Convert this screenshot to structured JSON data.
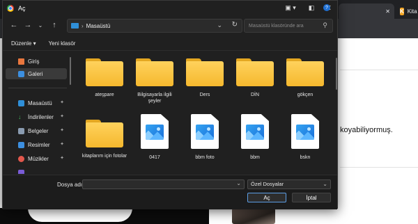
{
  "background": {
    "tab_k_letter": "K",
    "tab_k_label": "Kita",
    "article_text": "koyabiliyormuş."
  },
  "dialog": {
    "title": "Aç",
    "breadcrumb": {
      "location": "Masaüstü"
    },
    "search_placeholder": "Masaüstü klasöründe ara",
    "commands": {
      "organize": "Düzenle ▾",
      "new_folder": "Yeni klasör"
    },
    "sidebar": {
      "top_items": [
        {
          "label": "Giriş",
          "icon": "home-icon"
        },
        {
          "label": "Galeri",
          "icon": "gallery-icon"
        }
      ],
      "pinned_items": [
        {
          "label": "Masaüstü",
          "icon": "desktop-icon"
        },
        {
          "label": "İndirilenler",
          "icon": "download-icon"
        },
        {
          "label": "Belgeler",
          "icon": "document-icon"
        },
        {
          "label": "Resimler",
          "icon": "pictures-icon"
        },
        {
          "label": "Müzikler",
          "icon": "music-icon"
        }
      ]
    },
    "files": [
      {
        "name": "ateşpare",
        "type": "folder"
      },
      {
        "name": "Bilgisayarla ilgili şeyler",
        "type": "folder"
      },
      {
        "name": "Ders",
        "type": "folder"
      },
      {
        "name": "DİN",
        "type": "folder"
      },
      {
        "name": "gökçen",
        "type": "folder"
      },
      {
        "name": "kitaplarım için fotolar",
        "type": "folder"
      },
      {
        "name": "0417",
        "type": "image"
      },
      {
        "name": "bbm foto",
        "type": "image"
      },
      {
        "name": "bbm",
        "type": "image"
      },
      {
        "name": "bskn",
        "type": "image"
      }
    ],
    "footer": {
      "file_name_label": "Dosya adı:",
      "file_name_value": "",
      "file_type": "Özel Dosyalar",
      "open_label": "Aç",
      "cancel_label": "İptal"
    },
    "colors": {
      "accent": "#5c9ee6",
      "folder": "#f5b82e",
      "background": "#202020"
    }
  }
}
